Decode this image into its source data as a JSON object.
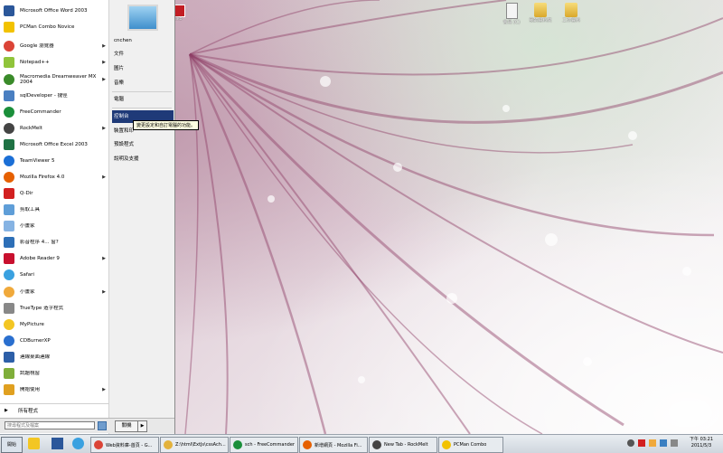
{
  "desktop": {
    "icons": [
      {
        "label": "會員 (C)",
        "type": "doc"
      },
      {
        "label": "我的資料夾",
        "type": "folder"
      },
      {
        "label": "工作資料",
        "type": "folder"
      }
    ],
    "small_icon_label": "Ziko"
  },
  "start_menu": {
    "programs": [
      {
        "label": "Microsoft Office Word 2003",
        "color": "#2b579a",
        "submenu": false
      },
      {
        "label": "PCMan Combo Novice",
        "color": "#f2c200",
        "submenu": false
      },
      {
        "label": "Google 瀏覽器",
        "color": "#db4437",
        "submenu": true
      },
      {
        "label": "Notepad++",
        "color": "#90c43b",
        "submenu": true
      },
      {
        "label": "Macromedia Dreamweaver MX 2004",
        "color": "#3a8b2a",
        "submenu": true
      },
      {
        "label": "sqlDeveloper - 捷徑",
        "color": "#4a7fc1",
        "submenu": false
      },
      {
        "label": "FreeCommander",
        "color": "#1a8f3a",
        "submenu": false
      },
      {
        "label": "RockMelt",
        "color": "#444444",
        "submenu": true
      },
      {
        "label": "Microsoft Office Excel 2003",
        "color": "#1f7244",
        "submenu": false
      },
      {
        "label": "TeamViewer 5",
        "color": "#1b6fd6",
        "submenu": false
      },
      {
        "label": "Mozilla Firefox 4.0",
        "color": "#e66000",
        "submenu": true
      },
      {
        "label": "Q-Dir",
        "color": "#d22020",
        "submenu": false
      },
      {
        "label": "剪取工具",
        "color": "#5f9ed8",
        "submenu": false
      },
      {
        "label": "小畫家",
        "color": "#86b3e3",
        "submenu": false
      },
      {
        "label": "影音程序 4... 窗?",
        "color": "#2d6fb7",
        "submenu": false
      },
      {
        "label": "Adobe Reader 9",
        "color": "#c8102e",
        "submenu": true
      },
      {
        "label": "Safari",
        "color": "#3aa1e0",
        "submenu": false
      },
      {
        "label": "小畫家",
        "color": "#f0a93b",
        "submenu": true
      },
      {
        "label": "TrueType 造字程式",
        "color": "#888888",
        "submenu": false
      },
      {
        "label": "MyPicture",
        "color": "#f3c623",
        "submenu": false
      },
      {
        "label": "CDBurnerXP",
        "color": "#2a6fcf",
        "submenu": false
      },
      {
        "label": "連線桌面連線",
        "color": "#2d5fa8",
        "submenu": false
      },
      {
        "label": "試題視窗",
        "color": "#7fae3a",
        "submenu": false
      },
      {
        "label": "開始使用",
        "color": "#e0a020",
        "submenu": true
      }
    ],
    "all_programs_label": "所有程式",
    "search_placeholder": "搜尋程式及檔案",
    "shutdown_label": "關機",
    "right_items": [
      {
        "label": "cnchen",
        "selected": false
      },
      {
        "label": "文件",
        "selected": false
      },
      {
        "label": "圖片",
        "selected": false
      },
      {
        "label": "音樂",
        "selected": false
      },
      {
        "label": "電腦",
        "selected": false
      },
      {
        "label": "控制台",
        "selected": true
      },
      {
        "label": "裝置和印",
        "selected": false
      },
      {
        "label": "預設程式",
        "selected": false
      },
      {
        "label": "說明及支援",
        "selected": false
      }
    ],
    "tooltip": "變更設定和自訂電腦的功能。"
  },
  "taskbar": {
    "start_label": "開始",
    "tasks": [
      {
        "label": "Web資料庫-首頁 - G...",
        "color": "#db4437"
      },
      {
        "label": "Z:\\html\\ExtJs\\cssAch...",
        "color": "#e3b23c"
      },
      {
        "label": "sch - FreeCommander",
        "color": "#1a8f3a"
      },
      {
        "label": "新增網頁 - Mozilla Fi...",
        "color": "#e66000"
      },
      {
        "label": "New Tab - RockMelt",
        "color": "#444444"
      },
      {
        "label": "PCMan Combo",
        "color": "#f2c200"
      }
    ],
    "clock_time": "下午 03:21",
    "clock_date": "2011/5/3"
  }
}
